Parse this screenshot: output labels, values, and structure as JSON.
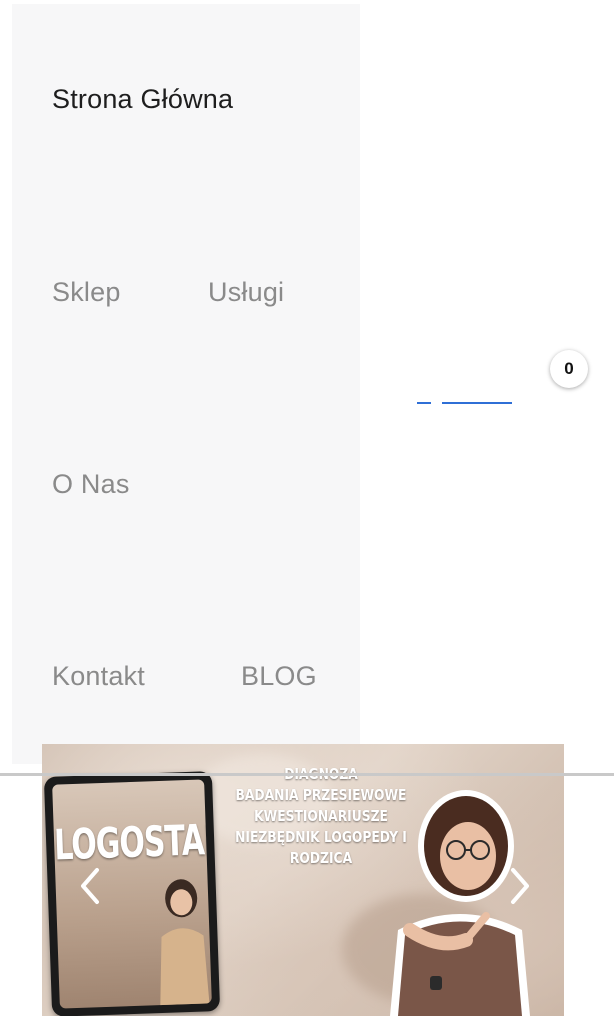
{
  "nav": {
    "home": "Strona Główna",
    "shop": "Sklep",
    "services": "Usługi",
    "about": "O Nas",
    "contact": "Kontakt",
    "blog": "BLOG"
  },
  "cart": {
    "count": "0"
  },
  "banner": {
    "tablet_title": "LOGOSTART",
    "lines": [
      "DIAGNOZA",
      "BADANIA PRZESIEWOWE",
      "KWESTIONARIUSZE",
      "NIEZBĘDNIK LOGOPEDY I",
      "RODZICA"
    ],
    "prev_icon": "chevron-left-icon",
    "next_icon": "chevron-right-icon"
  },
  "colors": {
    "nav_active": "#1e1e1e",
    "nav_inactive": "#8a8a8a",
    "nav_background": "#f7f7f8",
    "accent_blue": "#2f6fd6"
  }
}
